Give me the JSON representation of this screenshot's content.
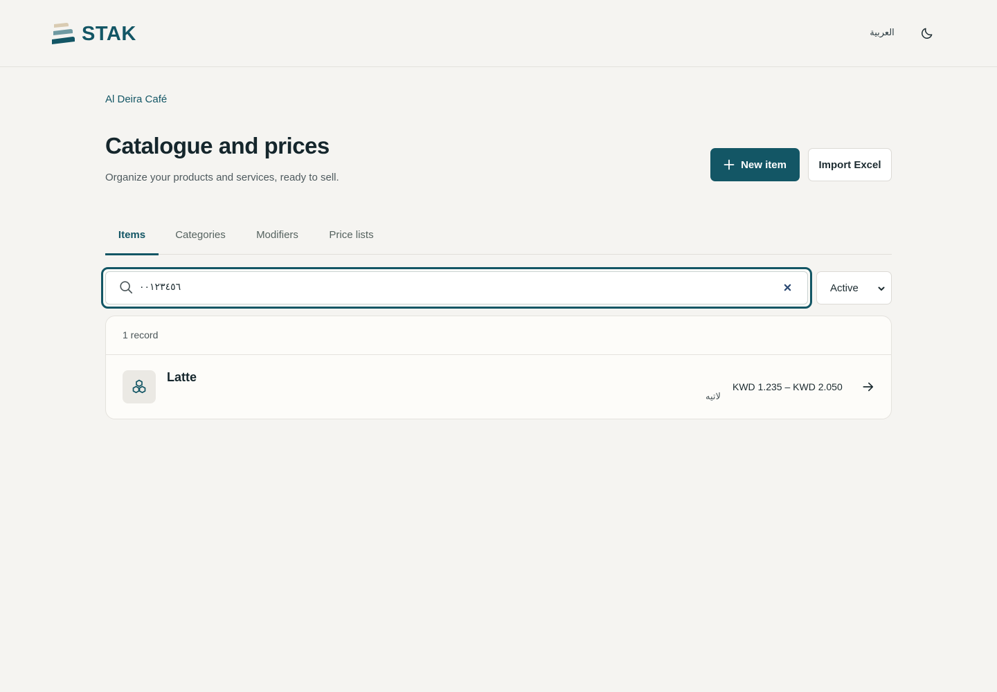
{
  "app": {
    "logo_text": "STAK",
    "language_link": "العربية",
    "theme_toggle_icon": "moon-icon"
  },
  "breadcrumb": "Al Deira Café",
  "header": {
    "title": "Catalogue and prices",
    "subtitle": "Organize your products and services, ready to sell.",
    "new_item_label": "New item",
    "import_label": "Import Excel"
  },
  "tabs": [
    {
      "label": "Items",
      "active": true
    },
    {
      "label": "Categories",
      "active": false
    },
    {
      "label": "Modifiers",
      "active": false
    },
    {
      "label": "Price lists",
      "active": false
    }
  ],
  "search": {
    "value": "٠٠١٢٣٤٥٦",
    "placeholder": ""
  },
  "status_filter": {
    "selected": "Active"
  },
  "results": {
    "count_label": "1 record",
    "items": [
      {
        "name": "Latte",
        "name_ar": "لاتيه",
        "price_range": "KWD 1.235 – KWD 2.050",
        "icon": "cubes-icon"
      }
    ]
  },
  "colors": {
    "brand": "#135665",
    "background": "#f5f4f1",
    "card": "#fdfcf9"
  }
}
